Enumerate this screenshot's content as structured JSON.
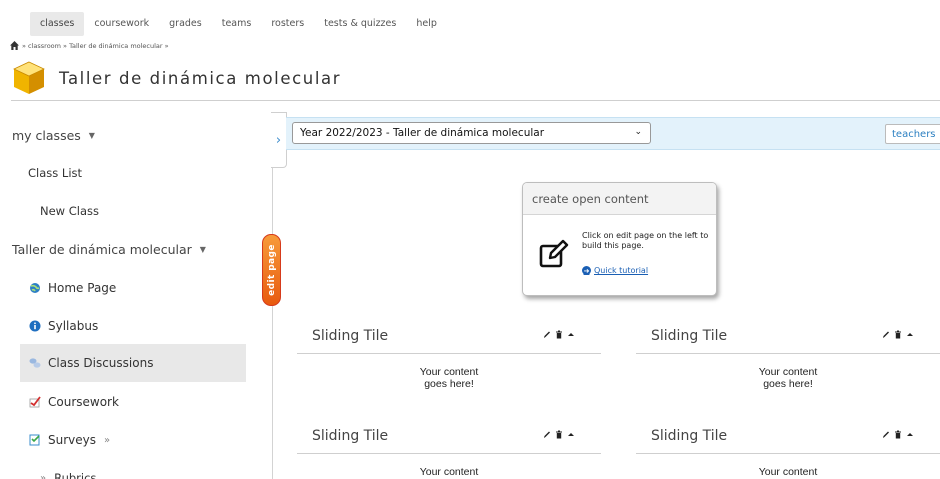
{
  "nav": {
    "items": [
      "classes",
      "coursework",
      "grades",
      "teams",
      "rosters",
      "tests & quizzes",
      "help"
    ],
    "active": "classes"
  },
  "breadcrumb": {
    "text": "» classroom » Taller de dinámica molecular »"
  },
  "page": {
    "title": "Taller de dinámica molecular"
  },
  "sidebar": {
    "my_classes": "my classes",
    "class_list": "Class List",
    "new_class": "New Class",
    "course_section": "Taller de dinámica molecular",
    "home_page": "Home Page",
    "syllabus": "Syllabus",
    "class_discussions": "Class Discussions",
    "coursework": "Coursework",
    "surveys": "Surveys",
    "rubrics": "Rubrics"
  },
  "edit_tab": {
    "label": "edit page"
  },
  "yearbar": {
    "selected": "Year 2022/2023 - Taller de dinámica molecular",
    "teachers": "teachers"
  },
  "open_content": {
    "heading": "create open content",
    "text": "Click on edit page on the left to build this page.",
    "link": "Quick tutorial"
  },
  "tiles": [
    {
      "title": "Sliding Tile",
      "line1": "Your content",
      "line2": "goes here!"
    },
    {
      "title": "Sliding Tile",
      "line1": "Your content",
      "line2": "goes here!"
    },
    {
      "title": "Sliding Tile",
      "line1": "Your content",
      "line2": ""
    },
    {
      "title": "Sliding Tile",
      "line1": "Your content",
      "line2": ""
    }
  ],
  "colors": {
    "accent_blue": "#3a8ccc",
    "yearbar_bg": "#e3f2fb",
    "edit_tab_orange": "#f07a25",
    "highlight_gray": "#e8e8e8"
  }
}
